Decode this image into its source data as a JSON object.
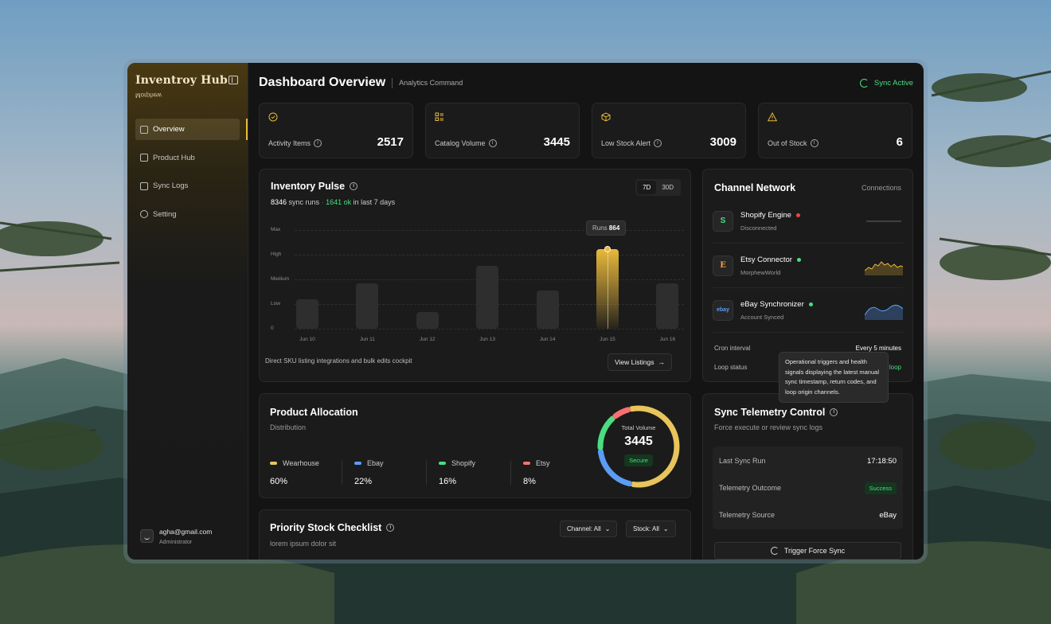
{
  "sidebar": {
    "brand": "Inventroy Hub",
    "brand_sub": "Morphew",
    "items": [
      {
        "label": "Overview"
      },
      {
        "label": "Product Hub"
      },
      {
        "label": "Sync Logs"
      },
      {
        "label": "Setting"
      }
    ],
    "user": {
      "email": "agha@gmail.com",
      "role": "Administrator"
    }
  },
  "header": {
    "title": "Dashboard Overview",
    "subtitle": "Analytics Command",
    "status": "Sync Active"
  },
  "stats": [
    {
      "label": "Activity Items",
      "value": "2517",
      "icon": "check-circle-icon"
    },
    {
      "label": "Catalog Volume",
      "value": "3445",
      "icon": "list-icon"
    },
    {
      "label": "Low Stock Alert",
      "value": "3009",
      "icon": "box-icon"
    },
    {
      "label": "Out of Stock",
      "value": "6",
      "icon": "warning-icon"
    }
  ],
  "pulse": {
    "title": "Inventory Pulse",
    "runs_count": "8346",
    "runs_label": "sync runs",
    "ok_text": "1641 ok",
    "ok_suffix": "in last 7 days",
    "range_options": [
      "7D",
      "30D"
    ],
    "tooltip_label": "Runs",
    "tooltip_value": "864",
    "footer_text": "Direct SKU listing integrations and bulk edits cockpit",
    "button_label": "View  Listings"
  },
  "chart_data": {
    "type": "bar",
    "y_tick_labels": [
      "Max",
      "High",
      "Medium",
      "Low",
      "0"
    ],
    "categories": [
      "Jun 10",
      "Jun 11",
      "Jun 12",
      "Jun 13",
      "Jun 14",
      "Jun 15",
      "Jun 16"
    ],
    "values": [
      0.3,
      0.46,
      0.17,
      0.64,
      0.39,
      0.81,
      0.46
    ],
    "ylim": [
      0,
      1
    ],
    "highlight_index": 5,
    "highlight_color": "#e8b93c",
    "grid": true
  },
  "channels": {
    "title": "Channel Network",
    "link": "Connections",
    "items": [
      {
        "name": "Shopify Engine",
        "status": "Disconnected",
        "status_color": "#ef4444",
        "logo": "S"
      },
      {
        "name": "Etsy Connector",
        "status": "MorphewWorld",
        "status_color": "#4ade80",
        "logo": "E"
      },
      {
        "name": "eBay Synchronizer",
        "status": "Account Synced",
        "status_color": "#4ade80",
        "logo": "ebay"
      }
    ],
    "cron_label": "Cron interval",
    "cron_value": "Every 5 minutes",
    "loop_label": "Loop status",
    "loop_value": "loop"
  },
  "allocation": {
    "title": "Product Allocation",
    "subtitle": "Distribution",
    "legend": [
      {
        "name": "Wearhouse",
        "value": "60%",
        "color": "#e8c45a"
      },
      {
        "name": "Ebay",
        "value": "22%",
        "color": "#5b9cf5"
      },
      {
        "name": "Shopify",
        "value": "16%",
        "color": "#4ade80"
      },
      {
        "name": "Etsy",
        "value": "8%",
        "color": "#f87171"
      }
    ],
    "donut_label": "Total Volume",
    "donut_value": "3445",
    "donut_badge": "Secure"
  },
  "checklist": {
    "title": "Priority Stock Checklist",
    "subtitle": "lorem ipsum dolor sit",
    "filter_channel": "Channel: All",
    "filter_stock": "Stock: All"
  },
  "telemetry": {
    "title": "Sync Telemetry Control",
    "subtitle": "Force execute or review sync logs",
    "rows": [
      {
        "label": "Last Sync Run",
        "value": "17:18:50"
      },
      {
        "label": "Telemetry Outcome",
        "value": "Success"
      },
      {
        "label": "Telemetry Source",
        "value": "eBay"
      }
    ],
    "button_label": "Trigger Force Sync",
    "tooltip": "Operational triggers and health signals displaying the latest manual sync timestamp, return codes, and loop origin channels."
  }
}
